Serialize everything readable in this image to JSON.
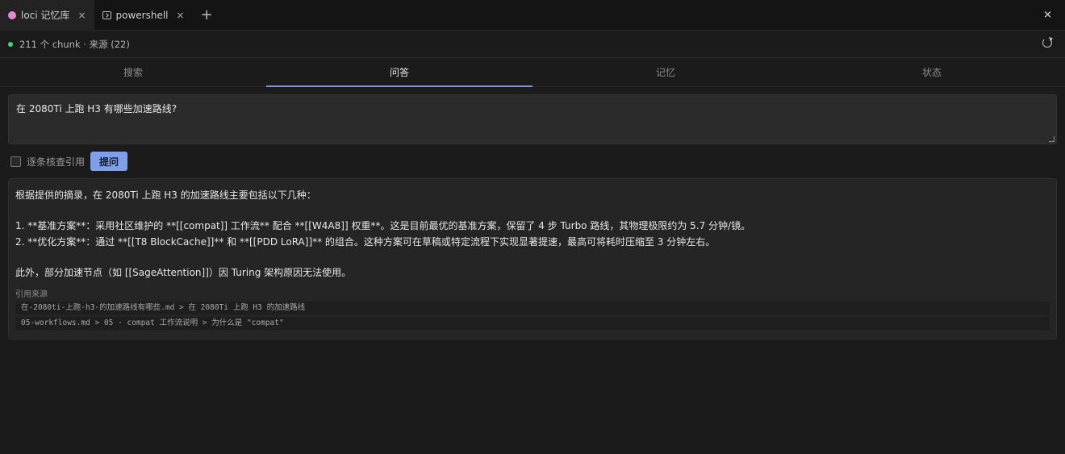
{
  "tabs": [
    {
      "label": "loci 记忆库",
      "icon": "brain-icon",
      "close": "×"
    },
    {
      "label": "powershell",
      "icon": "terminal-icon",
      "close": "×"
    }
  ],
  "new_tab": "+",
  "window_close": "×",
  "status": {
    "text": "211 个 chunk · 来源 (22)",
    "indicator_color": "#4bd27a"
  },
  "nav": {
    "items": [
      "搜索",
      "问答",
      "记忆",
      "状态"
    ],
    "active": "问答"
  },
  "question": {
    "value": "在 2080Ti 上跑 H3 有哪些加速路线?"
  },
  "controls": {
    "checkbox_label": "逐条核查引用",
    "checked": false,
    "ask_button": "提问"
  },
  "answer": {
    "intro": "根据提供的摘录，在 2080Ti 上跑 H3 的加速路线主要包括以下几种：",
    "item1": "1. **基准方案**：采用社区维护的 **[[compat]] 工作流** 配合 **[[W4A8]] 权重**。这是目前最优的基准方案，保留了 4 步 Turbo 路线，其物理极限约为 5.7 分钟/镜。",
    "item2": "2. **优化方案**：通过 **[[T8 BlockCache]]** 和 **[[PDD LoRA]]** 的组合。这种方案可在草稿或特定流程下实现显著提速，最高可将耗时压缩至 3 分钟左右。",
    "outro": "此外，部分加速节点（如 [[SageAttention]]）因 Turing 架构原因无法使用。"
  },
  "sources": {
    "title": "引用来源",
    "items": [
      "在-2080ti-上跑-h3-的加速路线有哪些.md > 在 2080Ti 上跑 H3 的加速路线",
      "05-workflows.md > 05 · compat 工作流说明 > 为什么是 \"compat\""
    ]
  },
  "colors": {
    "accent": "#7f9fe8",
    "tab_underline": "#7b96d9"
  }
}
